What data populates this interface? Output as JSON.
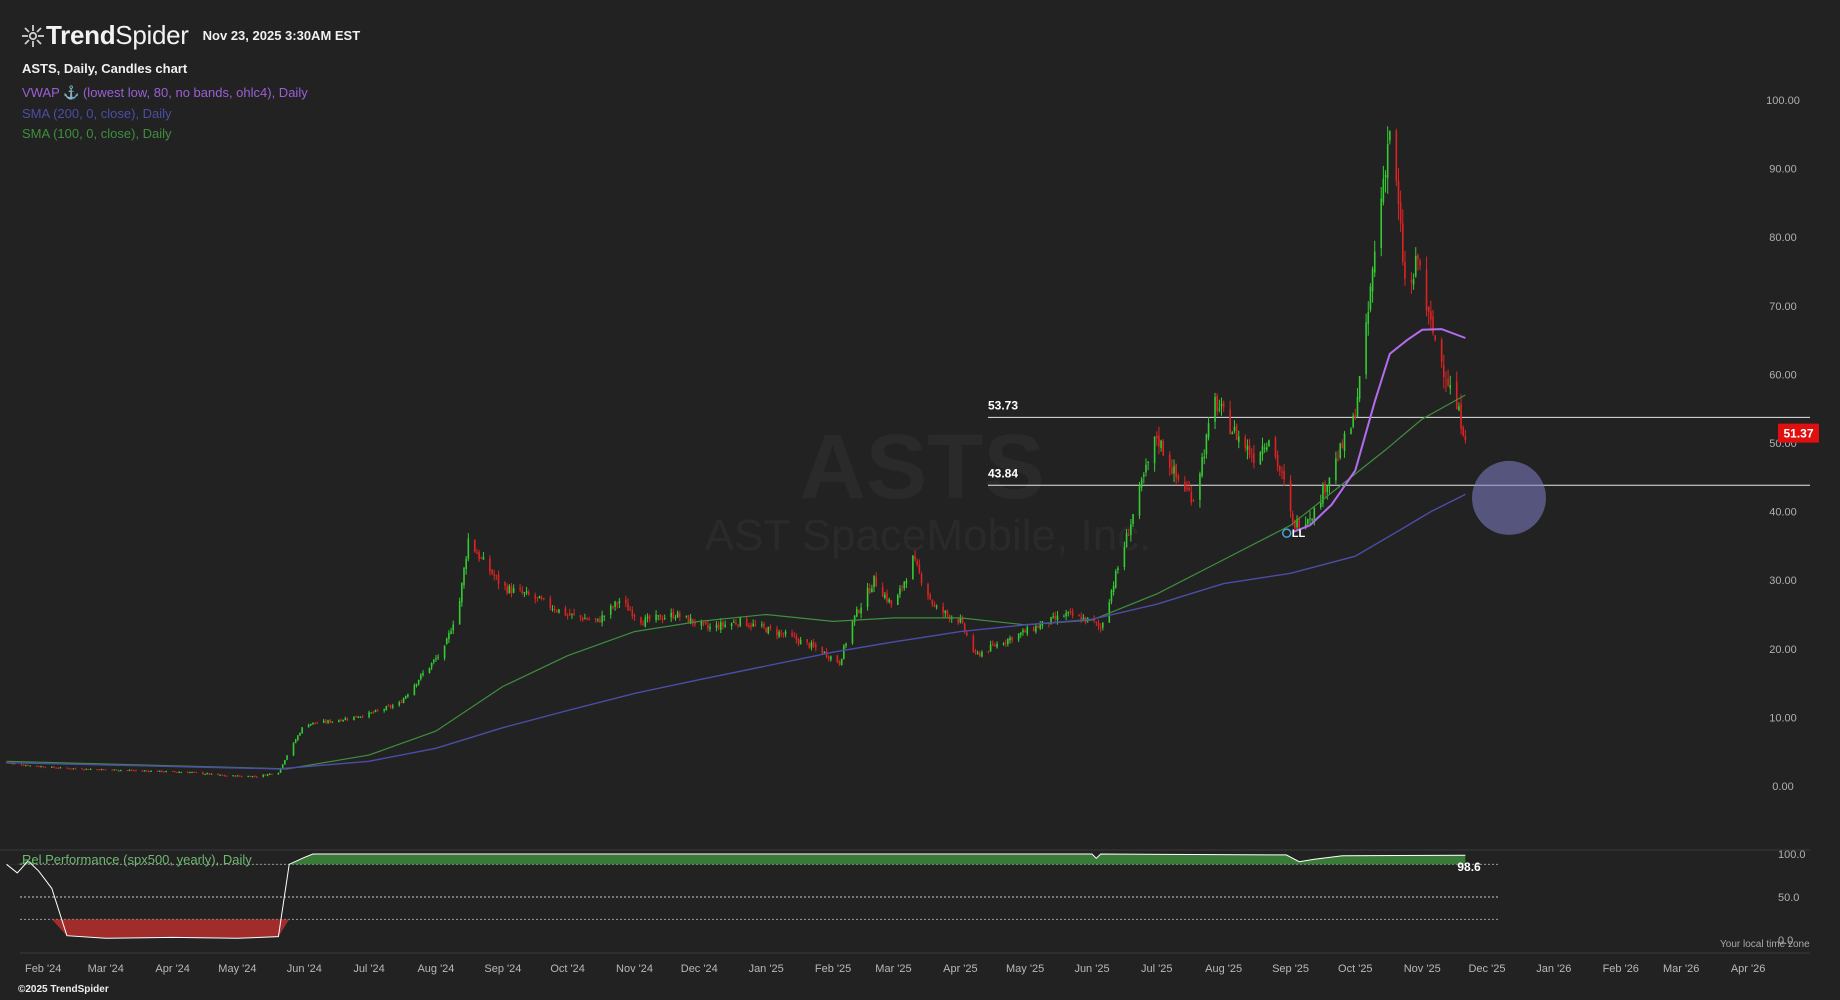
{
  "header": {
    "brand_first": "Trend",
    "brand_second": "Spider",
    "datetime": "Nov 23, 2025 3:30AM EST"
  },
  "chart_title": "ASTS, Daily, Candles chart",
  "indicators": [
    {
      "label": "VWAP ⚓ (lowest low, 80, no bands, ohlc4), Daily",
      "color": "#9b5fd6"
    },
    {
      "label": "SMA (200, 0, close), Daily",
      "color": "#4b4ea8"
    },
    {
      "label": "SMA (100, 0, close), Daily",
      "color": "#3e8f3e"
    }
  ],
  "watermark": {
    "symbol": "ASTS",
    "name": "AST SpaceMobile, Inc."
  },
  "anchor_label": "LL",
  "current_price": "51.37",
  "lower_panel": {
    "label": "Rel.Performance (spx500, yearly), Daily",
    "value_label": "98.6",
    "axis": [
      "100.0",
      "50.0",
      "0.0"
    ]
  },
  "local_time_label": "Your local time zone",
  "footer": "©2025 TrendSpider",
  "colors": {
    "background": "#222222",
    "up": "#33cc33",
    "down": "#dd2222",
    "vwap": "#b36cf0",
    "sma200": "#4b4ea8",
    "sma100": "#3e8f3e",
    "price_tag": "#e01010",
    "highlight": "#8080c8"
  },
  "chart_data": {
    "type": "candlestick",
    "y_ticks": [
      0,
      10,
      20,
      30,
      40,
      50,
      60,
      70,
      80,
      90,
      100
    ],
    "ylim": [
      -2,
      102
    ],
    "x_tick_labels": [
      "Feb '24",
      "Mar '24",
      "Apr '24",
      "May '24",
      "Jun '24",
      "Jul '24",
      "Aug '24",
      "Sep '24",
      "Oct '24",
      "Nov '24",
      "Dec '24",
      "Jan '25",
      "Feb '25",
      "Mar '25",
      "Apr '25",
      "May '25",
      "Jun '25",
      "Jul '25",
      "Aug '25",
      "Sep '25",
      "Oct '25",
      "Nov '25",
      "Dec '25",
      "Jan '26",
      "Feb '26",
      "Mar '26",
      "Apr '26"
    ],
    "x_start": "2024-01-12",
    "x_end": "2026-05-02",
    "last_date": "2025-11-21",
    "horizontal_levels": [
      53.73,
      43.84
    ],
    "anchor_date": "2025-09-02",
    "highlight_value": 42,
    "close_path": [
      [
        "2024-01-15",
        3.4
      ],
      [
        "2024-01-25",
        3.0
      ],
      [
        "2024-02-10",
        2.6
      ],
      [
        "2024-03-01",
        2.4
      ],
      [
        "2024-03-20",
        2.2
      ],
      [
        "2024-04-10",
        2.0
      ],
      [
        "2024-04-25",
        1.5
      ],
      [
        "2024-05-10",
        1.4
      ],
      [
        "2024-05-20",
        2.0
      ],
      [
        "2024-05-24",
        4.5
      ],
      [
        "2024-06-01",
        9.0
      ],
      [
        "2024-06-15",
        9.5
      ],
      [
        "2024-07-01",
        10.5
      ],
      [
        "2024-07-15",
        12.0
      ],
      [
        "2024-07-25",
        16.0
      ],
      [
        "2024-08-05",
        20.0
      ],
      [
        "2024-08-12",
        27.0
      ],
      [
        "2024-08-16",
        36.0
      ],
      [
        "2024-08-22",
        33.0
      ],
      [
        "2024-09-01",
        29.0
      ],
      [
        "2024-09-15",
        27.5
      ],
      [
        "2024-10-01",
        25.0
      ],
      [
        "2024-10-15",
        24.0
      ],
      [
        "2024-10-25",
        27.0
      ],
      [
        "2024-11-05",
        24.0
      ],
      [
        "2024-11-20",
        25.0
      ],
      [
        "2024-12-05",
        23.0
      ],
      [
        "2024-12-20",
        24.0
      ],
      [
        "2025-01-10",
        22.0
      ],
      [
        "2025-01-25",
        20.0
      ],
      [
        "2025-02-04",
        18.0
      ],
      [
        "2025-02-10",
        24.0
      ],
      [
        "2025-02-20",
        30.0
      ],
      [
        "2025-03-01",
        26.0
      ],
      [
        "2025-03-10",
        33.0
      ],
      [
        "2025-03-20",
        26.0
      ],
      [
        "2025-04-01",
        24.0
      ],
      [
        "2025-04-08",
        19.0
      ],
      [
        "2025-04-20",
        21.0
      ],
      [
        "2025-05-05",
        23.0
      ],
      [
        "2025-05-20",
        25.0
      ],
      [
        "2025-06-01",
        24.0
      ],
      [
        "2025-06-05",
        23.0
      ],
      [
        "2025-06-15",
        34.0
      ],
      [
        "2025-06-25",
        45.0
      ],
      [
        "2025-07-01",
        51.0
      ],
      [
        "2025-07-10",
        45.0
      ],
      [
        "2025-07-18",
        42.0
      ],
      [
        "2025-07-28",
        56.0
      ],
      [
        "2025-08-05",
        52.0
      ],
      [
        "2025-08-15",
        48.0
      ],
      [
        "2025-08-22",
        51.0
      ],
      [
        "2025-08-29",
        44.0
      ],
      [
        "2025-09-02",
        38.0
      ],
      [
        "2025-09-12",
        40.0
      ],
      [
        "2025-09-20",
        46.0
      ],
      [
        "2025-09-30",
        53.0
      ],
      [
        "2025-10-05",
        63.0
      ],
      [
        "2025-10-09",
        75.0
      ],
      [
        "2025-10-13",
        86.0
      ],
      [
        "2025-10-17",
        96.0
      ],
      [
        "2025-10-21",
        84.0
      ],
      [
        "2025-10-25",
        70.0
      ],
      [
        "2025-10-30",
        77.0
      ],
      [
        "2025-11-04",
        68.0
      ],
      [
        "2025-11-10",
        62.0
      ],
      [
        "2025-11-15",
        57.0
      ],
      [
        "2025-11-21",
        51.37
      ]
    ],
    "series": [
      {
        "name": "SMA (100, 0, close), Daily",
        "points": [
          [
            "2024-01-15",
            3.6
          ],
          [
            "2024-05-24",
            2.5
          ],
          [
            "2024-07-01",
            4.5
          ],
          [
            "2024-08-01",
            8.0
          ],
          [
            "2024-09-01",
            14.5
          ],
          [
            "2024-10-01",
            19.0
          ],
          [
            "2024-11-01",
            22.5
          ],
          [
            "2024-12-01",
            24.0
          ],
          [
            "2025-01-01",
            25.0
          ],
          [
            "2025-02-01",
            24.0
          ],
          [
            "2025-03-01",
            24.5
          ],
          [
            "2025-04-01",
            24.5
          ],
          [
            "2025-05-01",
            23.5
          ],
          [
            "2025-06-01",
            24.2
          ],
          [
            "2025-07-01",
            28.0
          ],
          [
            "2025-08-01",
            33.0
          ],
          [
            "2025-09-01",
            38.0
          ],
          [
            "2025-10-01",
            45.5
          ],
          [
            "2025-10-15",
            49.0
          ],
          [
            "2025-11-01",
            53.5
          ],
          [
            "2025-11-21",
            57.0
          ]
        ]
      },
      {
        "name": "SMA (200, 0, close), Daily",
        "points": [
          [
            "2024-01-15",
            3.4
          ],
          [
            "2024-05-20",
            2.5
          ],
          [
            "2024-07-01",
            3.6
          ],
          [
            "2024-08-01",
            5.5
          ],
          [
            "2024-09-01",
            8.5
          ],
          [
            "2024-10-01",
            11.0
          ],
          [
            "2024-11-01",
            13.5
          ],
          [
            "2024-12-01",
            15.5
          ],
          [
            "2025-01-01",
            17.5
          ],
          [
            "2025-02-01",
            19.5
          ],
          [
            "2025-03-01",
            21.0
          ],
          [
            "2025-04-01",
            22.5
          ],
          [
            "2025-05-01",
            23.5
          ],
          [
            "2025-06-01",
            24.3
          ],
          [
            "2025-07-01",
            26.5
          ],
          [
            "2025-08-01",
            29.5
          ],
          [
            "2025-09-01",
            31.0
          ],
          [
            "2025-10-01",
            33.5
          ],
          [
            "2025-10-20",
            37.0
          ],
          [
            "2025-11-05",
            40.0
          ],
          [
            "2025-11-21",
            42.5
          ]
        ]
      },
      {
        "name": "VWAP ⚓ (lowest low, 80, no bands, ohlc4), Daily",
        "points": [
          [
            "2025-09-02",
            37.0
          ],
          [
            "2025-09-10",
            38.0
          ],
          [
            "2025-09-20",
            41.0
          ],
          [
            "2025-10-01",
            46.0
          ],
          [
            "2025-10-10",
            56.0
          ],
          [
            "2025-10-17",
            63.0
          ],
          [
            "2025-10-25",
            65.0
          ],
          [
            "2025-11-01",
            66.5
          ],
          [
            "2025-11-10",
            66.6
          ],
          [
            "2025-11-21",
            65.3
          ]
        ]
      }
    ],
    "rel_performance": {
      "ylim": [
        0,
        100
      ],
      "reference_levels": [
        88,
        50,
        24
      ],
      "points": [
        [
          "2024-01-15",
          88
        ],
        [
          "2024-01-20",
          78
        ],
        [
          "2024-01-25",
          92
        ],
        [
          "2024-01-30",
          80
        ],
        [
          "2024-02-05",
          60
        ],
        [
          "2024-02-12",
          5
        ],
        [
          "2024-03-01",
          2
        ],
        [
          "2024-04-01",
          3
        ],
        [
          "2024-05-01",
          2
        ],
        [
          "2024-05-20",
          4
        ],
        [
          "2024-05-25",
          88
        ],
        [
          "2024-06-01",
          96
        ],
        [
          "2024-06-05",
          100
        ],
        [
          "2025-06-01",
          100
        ],
        [
          "2025-06-03",
          95
        ],
        [
          "2025-06-05",
          100
        ],
        [
          "2025-08-30",
          99
        ],
        [
          "2025-09-05",
          91
        ],
        [
          "2025-09-12",
          94
        ],
        [
          "2025-09-25",
          98
        ],
        [
          "2025-11-21",
          98.6
        ]
      ]
    }
  }
}
